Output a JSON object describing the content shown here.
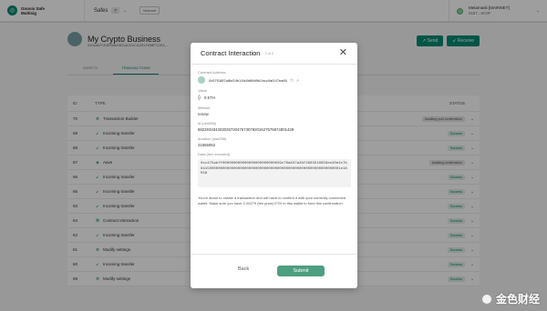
{
  "topbar": {
    "logo_text_line1": "Gnosis Safe",
    "logo_text_line2": "Multisig",
    "safes_label": "Safes",
    "safes_count": "7",
    "network": "Mainnet",
    "wallet_name": "Metamask [MAINNET]",
    "wallet_address": "0x87...6C8F"
  },
  "safe": {
    "name": "My Crypto Business",
    "address": "0x0ca57CE8F8Ab08114CDcCA2517658FC2E4...",
    "send_label": "Send",
    "receive_label": "Receive",
    "tabs": [
      "ASSETS",
      "TRANSACTIONS"
    ]
  },
  "table": {
    "headers": {
      "id": "ID",
      "type": "TYPE",
      "status": "STATUS"
    },
    "rows": [
      {
        "id": "70",
        "type": "Transaction Builder",
        "icon": "builder-icon",
        "amount": "",
        "date": "",
        "status": "Awaiting your confirmation"
      },
      {
        "id": "69",
        "type": "Incoming transfer",
        "icon": "incoming-icon",
        "amount": "",
        "date": "",
        "status": "Success"
      },
      {
        "id": "68",
        "type": "Incoming transfer",
        "icon": "incoming-icon",
        "amount": "",
        "date": "",
        "status": "Success"
      },
      {
        "id": "67",
        "type": "Aave",
        "icon": "aave-icon",
        "amount": "",
        "date": "",
        "status": "Awaiting confirmation"
      },
      {
        "id": "66",
        "type": "Incoming transfer",
        "icon": "incoming-icon",
        "amount": "",
        "date": "",
        "status": "Success"
      },
      {
        "id": "65",
        "type": "Incoming transfer",
        "icon": "incoming-icon",
        "amount": "",
        "date": "",
        "status": "Success"
      },
      {
        "id": "63",
        "type": "Incoming transfer",
        "icon": "incoming-icon",
        "amount": "",
        "date": "",
        "status": "Success"
      },
      {
        "id": "64",
        "type": "Contract Interaction",
        "icon": "contract-icon",
        "amount": "",
        "date": "",
        "status": "Success"
      },
      {
        "id": "62",
        "type": "Incoming transfer",
        "icon": "incoming-icon",
        "amount": "",
        "date": "",
        "status": "Success"
      },
      {
        "id": "61",
        "type": "Modify settings",
        "icon": "settings-icon",
        "amount": "",
        "date": "",
        "status": "Success"
      },
      {
        "id": "60",
        "type": "Incoming transfer",
        "icon": "incoming-icon",
        "amount": "The Proof of Attendance...",
        "date": "Apr 2, 2020 - 00:55:57",
        "status": "Success"
      },
      {
        "id": "59",
        "type": "Modify settings",
        "icon": "settings-icon",
        "amount": "n/a",
        "date": "Apr 2, 2020 - 00:15:57",
        "status": "Success"
      }
    ]
  },
  "modal": {
    "title": "Contract Interaction",
    "step": "2 of 2",
    "contract_address_label": "Contract Address",
    "contract_address": "0x57f1887a8bf19b14fc0df6fd9b2acc9af147ea85",
    "value_label": "Value",
    "value": "0 ETH",
    "method_label": "Method",
    "method": "renew",
    "id_label": "id (uint256)",
    "id": "58229343432302672047673079201627576874801429",
    "duration_label": "duration (uint256)",
    "duration": "31556952",
    "data_label": "Data (hex encoded)",
    "data": "0xc475abff000000000000000000000000029c70a837a28f2803510959ee20e4c7b6415000000000000000000000000000000000000000000000000000000000001e18558",
    "note": "You're about to create a transaction and will have to confirm it with your currently connected wallet. Make sure you have 0.00279 (fee price) ETH in this wallet to fund this confirmation.",
    "back_label": "Back",
    "submit_label": "Submit"
  },
  "watermark": {
    "text": "金色财经"
  },
  "colors": {
    "accent": "#008c73",
    "submit": "#4e9e80"
  }
}
